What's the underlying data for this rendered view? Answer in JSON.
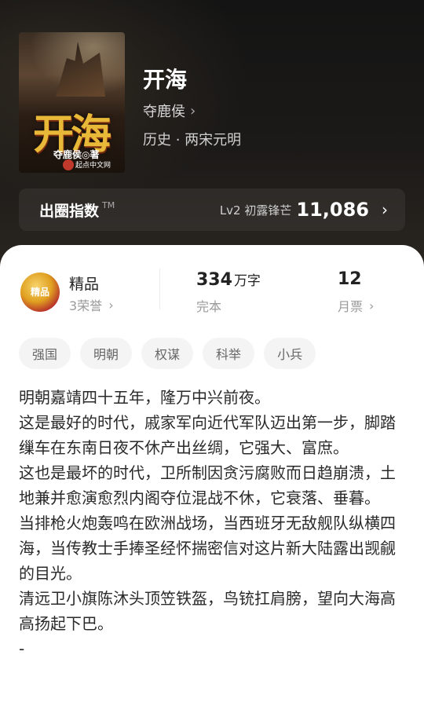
{
  "book": {
    "title": "开海",
    "author": "夺鹿侯",
    "category": "历史 · 两宋元明",
    "cover": {
      "title_art": "开海",
      "author": "夺鹿侯◎著",
      "publisher_logo": "起点中文网"
    }
  },
  "circle_index": {
    "label": "出圈指数",
    "tm": "TM",
    "level": "Lv2 初露锋芒",
    "value": "11,086"
  },
  "stats": {
    "quality": {
      "badge_text": "精品",
      "title": "精品",
      "honors": "3荣誉"
    },
    "words": {
      "value": "334",
      "unit": "万字",
      "status": "完本"
    },
    "tickets": {
      "value": "12",
      "label": "月票"
    }
  },
  "tags": [
    "强国",
    "明朝",
    "权谋",
    "科举",
    "小兵"
  ],
  "synopsis": "明朝嘉靖四十五年，隆万中兴前夜。\n这是最好的时代，戚家军向近代军队迈出第一步，脚踏缫车在东南日夜不休产出丝绸，它强大、富庶。\n这也是最坏的时代，卫所制因贪污腐败而日趋崩溃，土地兼并愈演愈烈内阁夺位混战不休，它衰落、垂暮。\n当排枪火炮轰鸣在欧洲战场，当西班牙无敌舰队纵横四海，当传教士手捧圣经怀揣密信对这片新大陆露出觊觎的目光。\n清远卫小旗陈沐头顶笠铁盔，鸟铳扛肩膀，望向大海高高扬起下巴。\n-",
  "icons": {
    "chevron": "›"
  },
  "colors": {
    "hero_bg": "#1c1a18",
    "text_primary": "#222222",
    "text_secondary": "#9a9a9a",
    "tag_bg": "#f4f4f4",
    "title_gold": "#e8b838"
  }
}
